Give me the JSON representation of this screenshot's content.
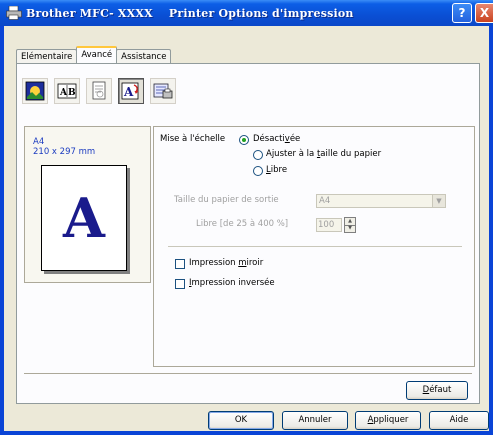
{
  "window": {
    "title": "Brother MFC- XXXX    Printer Options d'impression",
    "help_label": "?",
    "close_label": "X"
  },
  "tabs": [
    {
      "label": "Elémentaire",
      "active": false
    },
    {
      "label": "Avancé",
      "active": true
    },
    {
      "label": "Assistance",
      "active": false
    }
  ],
  "toolbar": {
    "buttons": [
      {
        "icon": "color-image-icon",
        "pressed": false
      },
      {
        "icon": "watermark-ab-icon",
        "pressed": false
      },
      {
        "icon": "document-stamp-icon",
        "pressed": false
      },
      {
        "icon": "scaling-a-icon",
        "pressed": true
      },
      {
        "icon": "printer-settings-icon",
        "pressed": false
      }
    ]
  },
  "preview": {
    "paper_name": "A4",
    "paper_dims": "210 x 297 mm",
    "page_letter": "A"
  },
  "scaling": {
    "label": "Mise à l'échelle",
    "options": [
      {
        "label": "Désactivée",
        "checked": true
      },
      {
        "label": "Ajuster à la taille du papier",
        "checked": false
      },
      {
        "label": "Libre",
        "checked": false
      }
    ],
    "output_paper_label": "Taille du papier de sortie",
    "output_paper_value": "A4",
    "free_range_label": "Libre [de 25 à 400 %]",
    "free_value": "100"
  },
  "options": {
    "mirror_label": "Impression miroir",
    "mirror_checked": false,
    "reverse_label": "Impression inversée",
    "reverse_checked": false
  },
  "buttons": {
    "default": "Défaut",
    "ok": "OK",
    "cancel": "Annuler",
    "apply": "Appliquer",
    "help": "Aide"
  },
  "colors": {
    "titlebar": "#0a4fd4",
    "dialog_bg": "#ece9d8",
    "preview_text": "#1c3cc0",
    "page_letter": "#1a1b8c",
    "radio_dot": "#21a121"
  }
}
